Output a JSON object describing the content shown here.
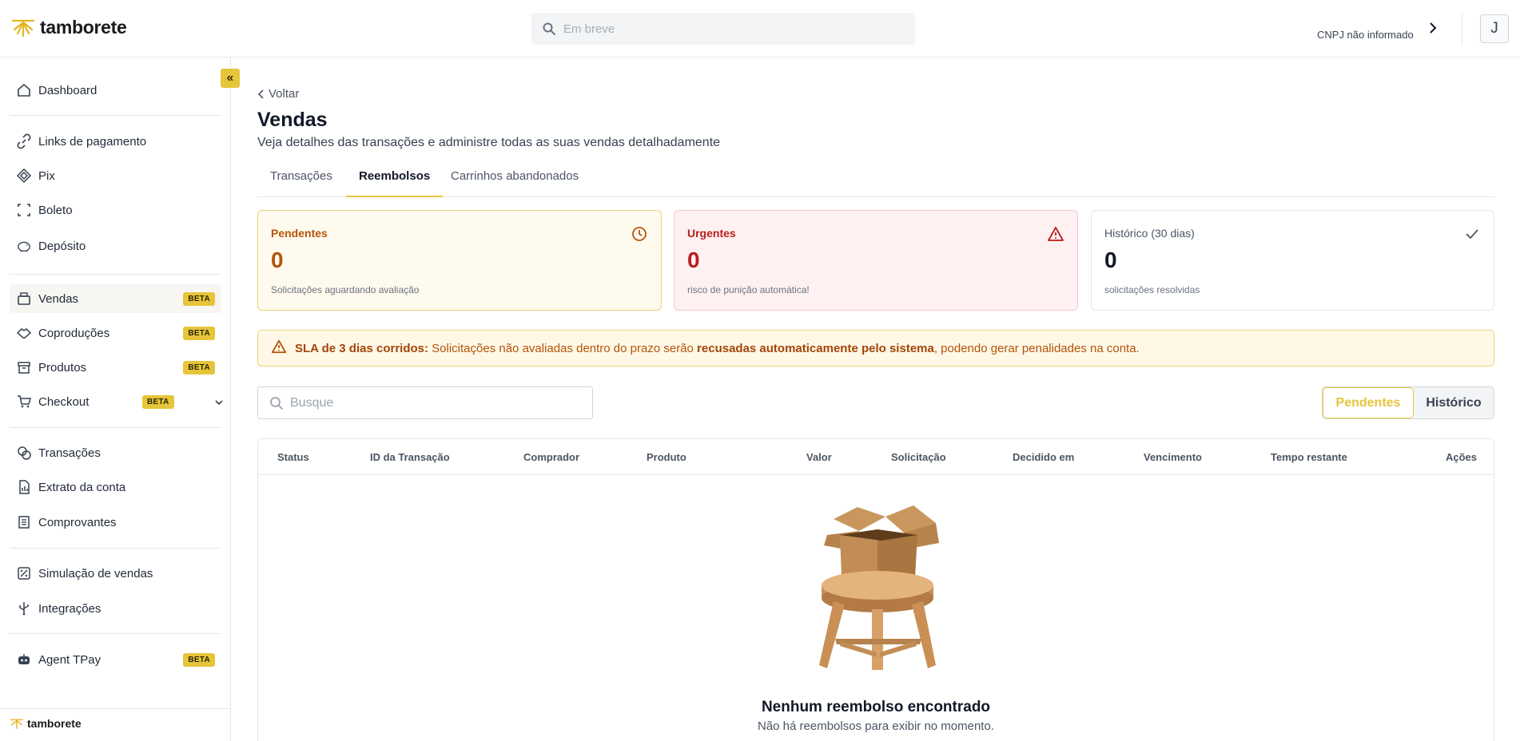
{
  "header": {
    "logo_text": "tamborete",
    "search_placeholder": "Em breve",
    "cnpj_text": "CNPJ não informado",
    "avatar_initial": "J"
  },
  "sidebar": {
    "items": [
      {
        "label": "Dashboard",
        "icon": "home-icon"
      },
      {
        "label": "Links de pagamento",
        "icon": "link-icon"
      },
      {
        "label": "Pix",
        "icon": "pix-icon"
      },
      {
        "label": "Boleto",
        "icon": "barcode-icon"
      },
      {
        "label": "Depósito",
        "icon": "piggy-bank-icon"
      },
      {
        "label": "Vendas",
        "icon": "register-icon",
        "badge": "BETA",
        "active": true
      },
      {
        "label": "Coproduções",
        "icon": "handshake-icon",
        "badge": "BETA"
      },
      {
        "label": "Produtos",
        "icon": "archive-icon",
        "badge": "BETA"
      },
      {
        "label": "Checkout",
        "icon": "cart-icon",
        "badge": "BETA"
      },
      {
        "label": "Transações",
        "icon": "coins-icon"
      },
      {
        "label": "Extrato da conta",
        "icon": "statement-icon"
      },
      {
        "label": "Comprovantes",
        "icon": "receipt-icon"
      },
      {
        "label": "Simulação de vendas",
        "icon": "percent-icon"
      },
      {
        "label": "Integrações",
        "icon": "usb-icon"
      },
      {
        "label": "Agent TPay",
        "icon": "bot-icon",
        "badge": "BETA"
      }
    ],
    "footer_logo": "tamborete"
  },
  "main": {
    "back_label": "Voltar",
    "title": "Vendas",
    "subtitle": "Veja detalhes das transações e administre todas as suas vendas detalhadamente",
    "tabs": [
      {
        "label": "Transações"
      },
      {
        "label": "Reembolsos",
        "active": true
      },
      {
        "label": "Carrinhos abandonados"
      }
    ],
    "cards": {
      "pending": {
        "title": "Pendentes",
        "value": "0",
        "desc": "Solicitações aguardando avaliação"
      },
      "urgent": {
        "title": "Urgentes",
        "value": "0",
        "desc": "risco de punição automática!"
      },
      "history": {
        "title": "Histórico (30 dias)",
        "value": "0",
        "desc": "solicitações resolvidas"
      }
    },
    "sla": {
      "bold1": "SLA de 3 dias corridos:",
      "text1": " Solicitações não avaliadas dentro do prazo serão ",
      "bold2": "recusadas automaticamente pelo sistema",
      "text2": ", podendo gerar penalidades na conta."
    },
    "search_placeholder": "Busque",
    "toggle": {
      "pending": "Pendentes",
      "history": "Histórico"
    },
    "table": {
      "columns": [
        "Status",
        "ID da Transação",
        "Comprador",
        "Produto",
        "Valor",
        "Solicitação",
        "Decidido em",
        "Vencimento",
        "Tempo restante",
        "Ações"
      ],
      "empty_title": "Nenhum reembolso encontrado",
      "empty_sub": "Não há reembolsos para exibir no momento."
    }
  },
  "colors": {
    "accent": "#e6c53a",
    "pending": "#b45309",
    "urgent": "#b91c1c"
  }
}
